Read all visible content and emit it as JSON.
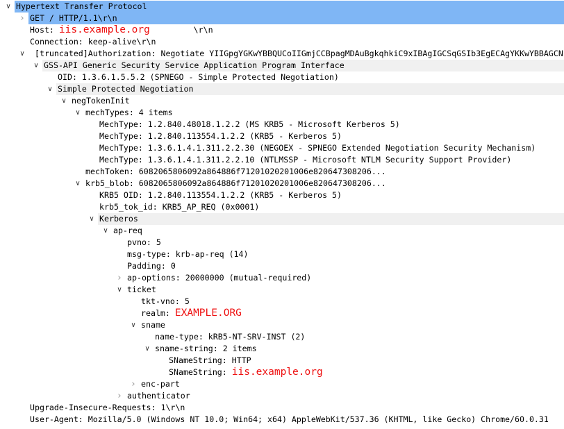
{
  "colors": {
    "selection": "#7fb6f5",
    "highlight_text": "#ee1111",
    "group_row": "#f0f0f0"
  },
  "tree": [
    {
      "level": 0,
      "expander": "open",
      "text": "Hypertext Transfer Protocol",
      "state": "selected"
    },
    {
      "level": 1,
      "expander": "closed",
      "text": "GET / HTTP/1.1\\r\\n",
      "state": "selected"
    },
    {
      "level": 1,
      "text": "Host: ",
      "highlight": "iis.example.org",
      "suffix": "         \\r\\n"
    },
    {
      "level": 1,
      "text": "Connection: keep-alive\\r\\n"
    },
    {
      "level": 1,
      "expander": "open",
      "text": " [truncated]Authorization: Negotiate YIIGpgYGKwYBBQUCoIIGmjCCBpagMDAuBgkqhkiC9xIBAgIGCSqGSIb3EgECAgYKKwYBBAGCN"
    },
    {
      "level": 2,
      "expander": "open",
      "text": "GSS-API Generic Security Service Application Program Interface",
      "state": "group"
    },
    {
      "level": 3,
      "text": "OID: 1.3.6.1.5.5.2 (SPNEGO - Simple Protected Negotiation)"
    },
    {
      "level": 3,
      "expander": "open",
      "text": "Simple Protected Negotiation",
      "state": "group"
    },
    {
      "level": 4,
      "expander": "open",
      "text": "negTokenInit"
    },
    {
      "level": 5,
      "expander": "open",
      "text": "mechTypes: 4 items"
    },
    {
      "level": 6,
      "text": "MechType: 1.2.840.48018.1.2.2 (MS KRB5 - Microsoft Kerberos 5)"
    },
    {
      "level": 6,
      "text": "MechType: 1.2.840.113554.1.2.2 (KRB5 - Kerberos 5)"
    },
    {
      "level": 6,
      "text": "MechType: 1.3.6.1.4.1.311.2.2.30 (NEGOEX - SPNEGO Extended Negotiation Security Mechanism)"
    },
    {
      "level": 6,
      "text": "MechType: 1.3.6.1.4.1.311.2.2.10 (NTLMSSP - Microsoft NTLM Security Support Provider)"
    },
    {
      "level": 5,
      "text": "mechToken: 6082065806092a864886f71201020201006e820647308206..."
    },
    {
      "level": 5,
      "expander": "open",
      "text": "krb5_blob: 6082065806092a864886f71201020201006e820647308206..."
    },
    {
      "level": 6,
      "text": "KRB5 OID: 1.2.840.113554.1.2.2 (KRB5 - Kerberos 5)"
    },
    {
      "level": 6,
      "text": "krb5_tok_id: KRB5_AP_REQ (0x0001)"
    },
    {
      "level": 6,
      "expander": "open",
      "text": "Kerberos",
      "state": "group"
    },
    {
      "level": 7,
      "expander": "open",
      "text": "ap-req"
    },
    {
      "level": 8,
      "text": "pvno: 5"
    },
    {
      "level": 8,
      "text": "msg-type: krb-ap-req (14)"
    },
    {
      "level": 8,
      "text": "Padding: 0"
    },
    {
      "level": 8,
      "expander": "closed",
      "text": "ap-options: 20000000 (mutual-required)"
    },
    {
      "level": 8,
      "expander": "open",
      "text": "ticket"
    },
    {
      "level": 9,
      "text": "tkt-vno: 5"
    },
    {
      "level": 9,
      "text": "realm: ",
      "highlight": "EXAMPLE.ORG"
    },
    {
      "level": 9,
      "expander": "open",
      "text": "sname"
    },
    {
      "level": 10,
      "text": "name-type: kRB5-NT-SRV-INST (2)"
    },
    {
      "level": 10,
      "expander": "open",
      "text": "sname-string: 2 items"
    },
    {
      "level": 11,
      "text": "SNameString: HTTP"
    },
    {
      "level": 11,
      "text": "SNameString: ",
      "highlight": "iis.example.org"
    },
    {
      "level": 9,
      "expander": "closed",
      "text": "enc-part"
    },
    {
      "level": 8,
      "expander": "closed",
      "text": "authenticator"
    },
    {
      "level": 1,
      "text": "Upgrade-Insecure-Requests: 1\\r\\n"
    },
    {
      "level": 1,
      "text": "User-Agent: Mozilla/5.0 (Windows NT 10.0; Win64; x64) AppleWebKit/537.36 (KHTML, like Gecko) Chrome/60.0.31"
    }
  ]
}
